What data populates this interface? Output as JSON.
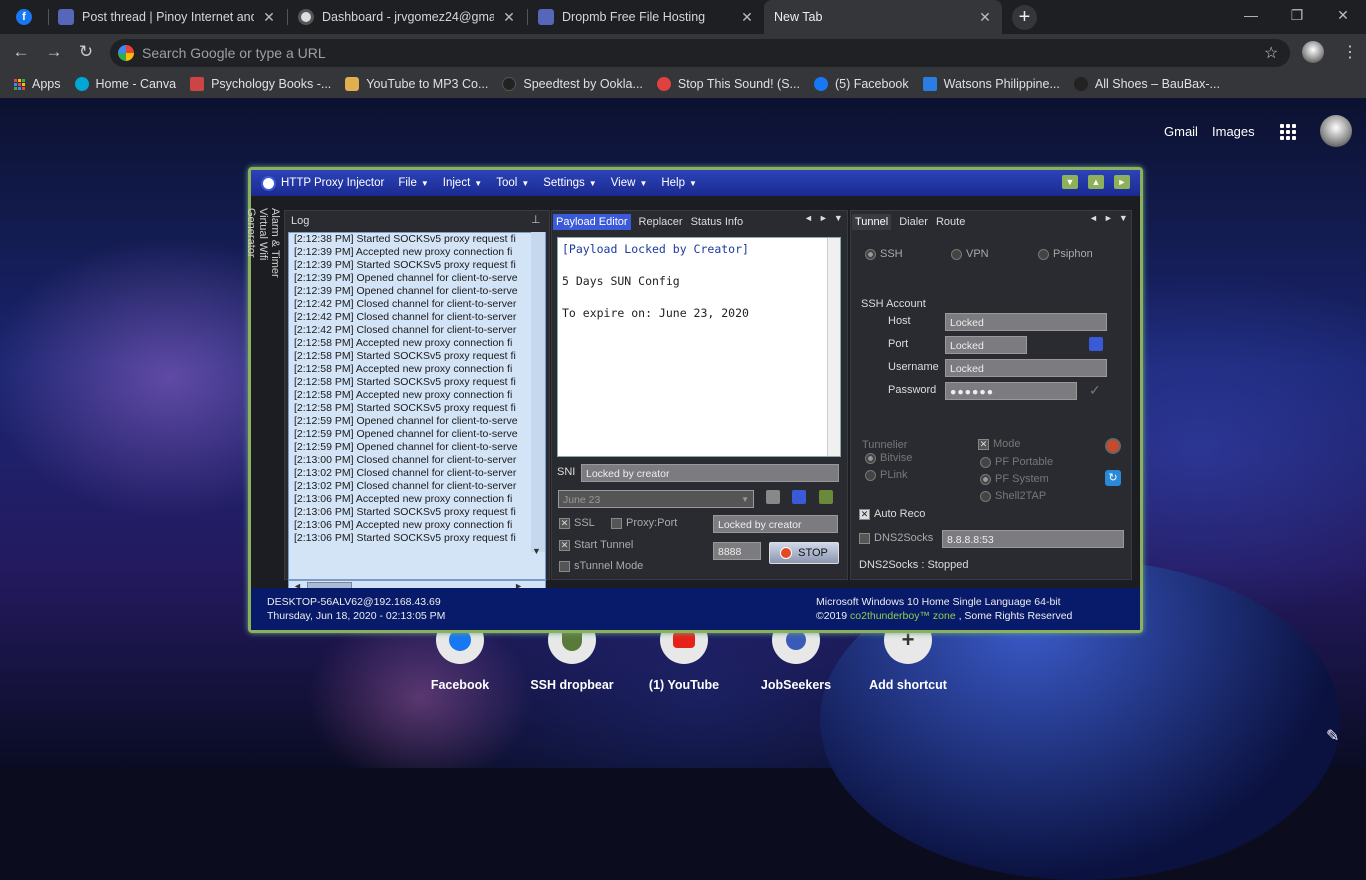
{
  "browser": {
    "tabs": [
      {
        "title": "Post thread | Pinoy Internet and T",
        "icon": "vbulletin-shield-icon"
      },
      {
        "title": "Dashboard - jrvgomez24@gmail",
        "icon": "globe-dark-icon"
      },
      {
        "title": "Dropmb Free File Hosting",
        "icon": "vbulletin-shield-icon"
      },
      {
        "title": "New Tab",
        "icon": ""
      }
    ],
    "omnibox_placeholder": "Search Google or type a URL",
    "bookmarks": [
      {
        "label": "Apps",
        "icon": "apps-grid-icon",
        "color": "#e8453c"
      },
      {
        "label": "Home - Canva",
        "icon": "canva-icon",
        "color": "#00a7d6"
      },
      {
        "label": "Psychology Books -...",
        "icon": "book-icon",
        "color": "#c44"
      },
      {
        "label": "YouTube to MP3 Co...",
        "icon": "converter-icon",
        "color": "#e0b050"
      },
      {
        "label": "Speedtest by Ookla...",
        "icon": "speedtest-icon",
        "color": "#222"
      },
      {
        "label": "Stop This Sound! (S...",
        "icon": "fruit-icon",
        "color": "#e04040"
      },
      {
        "label": "(5) Facebook",
        "icon": "facebook-icon",
        "color": "#1877f2"
      },
      {
        "label": "Watsons Philippine...",
        "icon": "watsons-icon",
        "color": "#2a7de1"
      },
      {
        "label": "All Shoes – BauBax-...",
        "icon": "baubax-icon",
        "color": "#222"
      }
    ]
  },
  "newtab": {
    "gmail": "Gmail",
    "images": "Images",
    "shortcuts": [
      {
        "label": "Facebook",
        "icon": "facebook-icon"
      },
      {
        "label": "SSH dropbear",
        "icon": "shield-badge-icon"
      },
      {
        "label": "(1) YouTube",
        "icon": "youtube-icon"
      },
      {
        "label": "JobSeekers",
        "icon": "globe-icon"
      },
      {
        "label": "Add shortcut",
        "icon": "plus-icon"
      }
    ]
  },
  "injector": {
    "title": "HTTP Proxy Injector",
    "menus": [
      "File",
      "Inject",
      "Tool",
      "Settings",
      "View",
      "Help"
    ],
    "sidetabs": [
      "Alarm & Timer",
      "Virtual Wifi",
      "Generator"
    ],
    "log_title": "Log",
    "log_lines": [
      "[2:12:38 PM] Started SOCKSv5 proxy request fi",
      "[2:12:39 PM] Accepted new proxy connection fi",
      "[2:12:39 PM] Started SOCKSv5 proxy request fi",
      "[2:12:39 PM] Opened channel for client-to-serve",
      "[2:12:39 PM] Opened channel for client-to-serve",
      "[2:12:42 PM] Closed channel for client-to-server",
      "[2:12:42 PM] Closed channel for client-to-server",
      "[2:12:42 PM] Closed channel for client-to-server",
      "[2:12:58 PM] Accepted new proxy connection fi",
      "[2:12:58 PM] Started SOCKSv5 proxy request fi",
      "[2:12:58 PM] Accepted new proxy connection fi",
      "[2:12:58 PM] Started SOCKSv5 proxy request fi",
      "[2:12:58 PM] Accepted new proxy connection fi",
      "[2:12:58 PM] Started SOCKSv5 proxy request fi",
      "[2:12:59 PM] Opened channel for client-to-serve",
      "[2:12:59 PM] Opened channel for client-to-serve",
      "[2:12:59 PM] Opened channel for client-to-serve",
      "[2:13:00 PM] Closed channel for client-to-server",
      "[2:13:02 PM] Closed channel for client-to-server",
      "[2:13:02 PM] Closed channel for client-to-server",
      "[2:13:06 PM] Accepted new proxy connection fi",
      "[2:13:06 PM] Started SOCKSv5 proxy request fi",
      "[2:13:06 PM] Accepted new proxy connection fi",
      "[2:13:06 PM] Started SOCKSv5 proxy request fi"
    ],
    "center_tabs": [
      "Payload Editor",
      "Replacer",
      "Status Info"
    ],
    "payload_lines": [
      "[Payload Locked by Creator]",
      "5 Days SUN Config",
      "To expire on: June 23, 2020"
    ],
    "sni_label": "SNI",
    "sni_value": "Locked by creator",
    "date_select": "June 23",
    "ssl_label": "SSL",
    "proxyport_label": "Proxy:Port",
    "proxy_value": "Locked by creator",
    "start_tunnel_label": "Start Tunnel",
    "stunnel_label": "sTunnel Mode",
    "port_value": "8888",
    "stop_label": "STOP",
    "right_tabs": [
      "Tunnel",
      "Dialer",
      "Route"
    ],
    "modes": [
      "SSH",
      "VPN",
      "Psiphon"
    ],
    "ssh_account": "SSH Account",
    "host_label": "Host",
    "host_value": "Locked",
    "port_label": "Port",
    "port_field": "Locked",
    "username_label": "Username",
    "username_value": "Locked",
    "password_label": "Password",
    "password_value": "●●●●●●",
    "tunnelier": "Tunnelier",
    "bitvise": "Bitvise",
    "plink": "PLink",
    "mode_label": "Mode",
    "pf_portable": "PF Portable",
    "pf_system": "PF System",
    "shell2tap": "Shell2TAP",
    "auto_reco": "Auto Reco",
    "dns2socks": "DNS2Socks",
    "dns_value": "8.8.8.8:53",
    "dns_status": "DNS2Socks : Stopped",
    "footer": {
      "host": "DESKTOP-56ALV62@192.168.43.69",
      "datetime": "Thursday, Jun 18, 2020 - 02:13:05 PM",
      "os": "Microsoft Windows 10 Home Single Language 64-bit",
      "copyright_pre": "©2019 ",
      "copyright_brand": "co2thunderboy™ zone",
      "copyright_post": " , Some Rights Reserved"
    }
  },
  "colors": {
    "accent_green": "#8fb05a",
    "title_blue": "#2c44b8",
    "footer_blue": "#081a6a"
  }
}
